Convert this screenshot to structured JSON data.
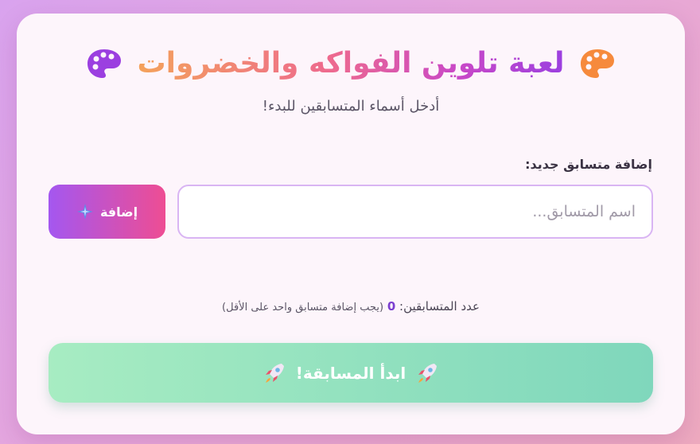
{
  "header": {
    "title": "لعبة تلوين الفواكه والخضروات",
    "subtitle": "أدخل أسماء المتسابقين للبدء!",
    "left_icon": "palette-icon",
    "right_icon": "palette-icon"
  },
  "add_form": {
    "label": "إضافة متسابق جديد:",
    "input_value": "",
    "input_placeholder": "اسم المتسابق...",
    "add_button_label": "إضافة",
    "add_button_icon": "sparkle-plus-icon"
  },
  "status": {
    "count_label": "عدد المتسابقين:",
    "count_value": "0",
    "count_note": "(يجب إضافة متسابق واحد على الأقل)"
  },
  "start": {
    "label": "ابدأ المسابقة!",
    "icon": "rocket-icon"
  },
  "colors": {
    "accent_purple": "#a457f0",
    "accent_pink": "#ee4d93",
    "start_green": "#a7ecc2",
    "title_orange": "#f4a25a"
  }
}
